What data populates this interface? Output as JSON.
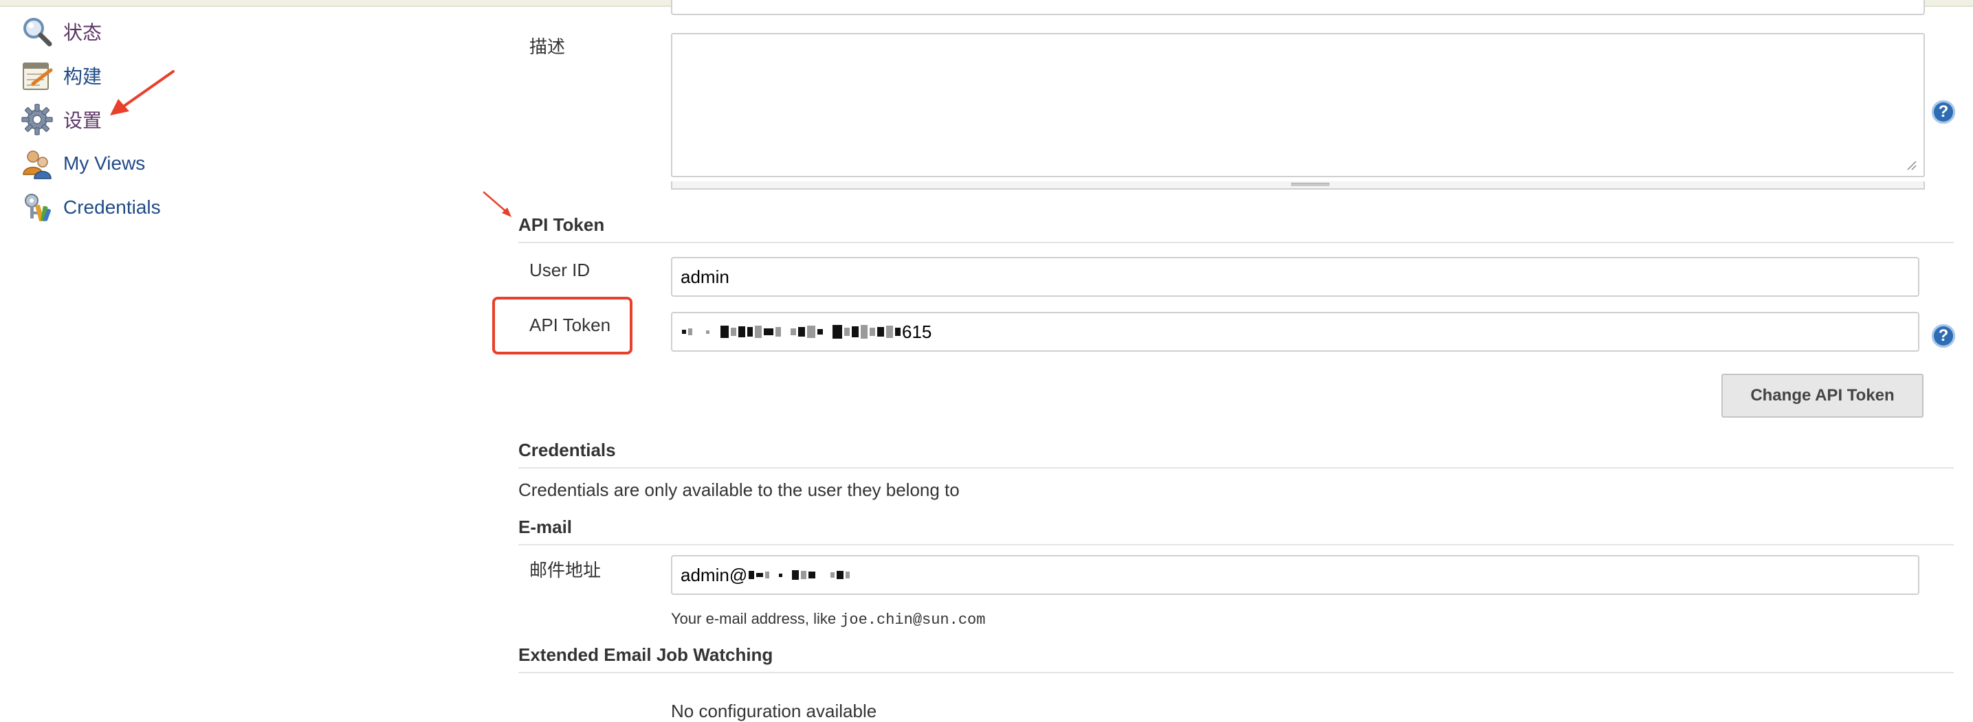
{
  "sidebar": {
    "items": [
      {
        "label": "状态",
        "icon": "search-icon"
      },
      {
        "label": "构建",
        "icon": "notepad-icon"
      },
      {
        "label": "设置",
        "icon": "gear-icon"
      },
      {
        "label": "My Views",
        "icon": "users-icon"
      },
      {
        "label": "Credentials",
        "icon": "credentials-icon"
      }
    ]
  },
  "form": {
    "description_label": "描述",
    "description_value": "",
    "api_section_title": "API Token",
    "user_id_label": "User ID",
    "user_id_value": "admin",
    "api_token_label": "API Token",
    "api_token_value_suffix": "615",
    "change_token_button": "Change API Token",
    "credentials_title": "Credentials",
    "credentials_text": "Credentials are only available to the user they belong to",
    "email_title": "E-mail",
    "email_label": "邮件地址",
    "email_value_prefix": "admin@",
    "email_hint_prefix": "Your e-mail address, like ",
    "email_hint_example": "joe.chin@sun.com",
    "watching_title": "Extended Email Job Watching",
    "watching_text": "No configuration available",
    "help_glyph": "?"
  },
  "colors": {
    "link": "#204A87",
    "visited_link": "#5c3566",
    "annotation_red": "#e8402a",
    "help_blue": "#2e6db4"
  }
}
